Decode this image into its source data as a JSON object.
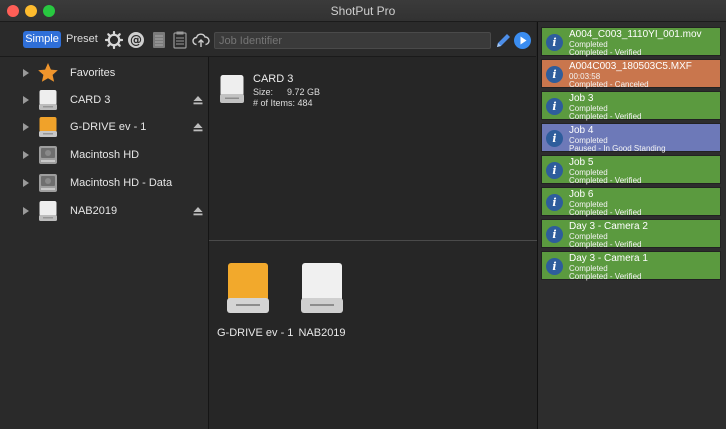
{
  "window": {
    "title": "ShotPut Pro"
  },
  "toolbar": {
    "simple_label": "Simple",
    "preset_label": "Preset",
    "job_identifier_placeholder": "Job Identifier",
    "icons": [
      "gear-icon",
      "at-sign-icon",
      "report-icon",
      "document-icon",
      "cloud-upload-icon",
      "pencil-icon",
      "play-icon"
    ]
  },
  "sidebar": {
    "items": [
      {
        "label": "Favorites",
        "icon": "star-icon",
        "eject": false
      },
      {
        "label": "CARD 3",
        "icon": "white-drive-icon",
        "eject": true
      },
      {
        "label": "G-DRIVE ev - 1",
        "icon": "orange-drive-icon",
        "eject": true
      },
      {
        "label": "Macintosh HD",
        "icon": "internal-drive-icon",
        "eject": false
      },
      {
        "label": "Macintosh HD - Data",
        "icon": "internal-drive-icon",
        "eject": false
      },
      {
        "label": "NAB2019",
        "icon": "white-drive-icon",
        "eject": true
      }
    ]
  },
  "source": {
    "name": "CARD 3",
    "size_label": "Size:",
    "size_value": "9.72 GB",
    "items_label": "# of Items:",
    "items_value": "484"
  },
  "destinations": [
    {
      "label": "G-DRIVE ev - 1",
      "icon": "orange-drive-icon"
    },
    {
      "label": "NAB2019",
      "icon": "white-drive-icon"
    }
  ],
  "jobs": [
    {
      "title": "A004_C003_1110YI_001.mov",
      "line2": "Completed",
      "line3": "Completed - Verified",
      "status": "green"
    },
    {
      "title": "A004C003_180503C5.MXF",
      "line2": "00:03:58",
      "line3": "Completed - Canceled",
      "status": "orange"
    },
    {
      "title": "Job 3",
      "line2": "Completed",
      "line3": "Completed - Verified",
      "status": "green"
    },
    {
      "title": "Job 4",
      "line2": "Completed",
      "line3": "Paused - In Good Standing",
      "status": "blue"
    },
    {
      "title": "Job 5",
      "line2": "Completed",
      "line3": "Completed - Verified",
      "status": "green"
    },
    {
      "title": "Job 6",
      "line2": "Completed",
      "line3": "Completed - Verified",
      "status": "green"
    },
    {
      "title": "Day 3 - Camera 2",
      "line2": "Completed",
      "line3": "Completed - Verified",
      "status": "green"
    },
    {
      "title": "Day 3 - Camera 1",
      "line2": "Completed",
      "line3": "Completed - Verified",
      "status": "green"
    }
  ],
  "colors": {
    "accent": "#2f6fd8",
    "job_completed": "#5b9a3f",
    "job_canceled": "#c9764d",
    "job_paused": "#6d79b8"
  }
}
